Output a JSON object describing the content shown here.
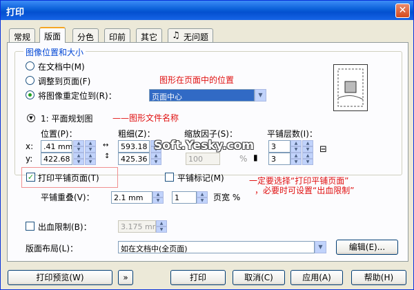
{
  "window": {
    "title": "打印",
    "close": "✕"
  },
  "tabs": [
    "常规",
    "版面",
    "分色",
    "印前",
    "其它",
    "无问题"
  ],
  "group": {
    "title": "图像位置和大小",
    "radio1": "在文档中(M)",
    "radio2": "调整到页面(F)",
    "radio3": "将图像重定位到(R)：",
    "reposition_value": "页面中心",
    "annotation_position": "图形在页面中的位置",
    "plan_label": "1: 平面规划图",
    "annotation_file": "——图形文件名称",
    "position_label": "位置(P)：",
    "x_label": "x:",
    "y_label": "y:",
    "x_value": ".41 mm",
    "y_value": "422.68",
    "size_label": "粗细(Z)：",
    "width_value": "593.18",
    "height_value": "425.36",
    "scale_label": "缩放因子(S)：",
    "scale_value": "100",
    "scale_unit": "%",
    "tile_count_label": "平铺层数(I)：",
    "tile_x": "3",
    "tile_y": "3"
  },
  "tile_pages": {
    "label": "打印平铺页面(T)",
    "checked": true
  },
  "tile_marks": {
    "label": "平铺标记(M)",
    "checked": false
  },
  "annotation_tile": [
    "一定要选择“打印平铺页面”",
    "，必要时可设置“出血限制”"
  ],
  "tile_overlap": {
    "label": "平铺重叠(V)：",
    "value": "2.1 mm",
    "pages_value": "1",
    "pages_label": "页宽 %"
  },
  "bleed": {
    "label": "出血限制(B)：",
    "value": "3.175 mm",
    "checked": false
  },
  "layout": {
    "label": "版面布局(L)：",
    "value": "如在文档中(全页面)",
    "edit": "编辑(E)..."
  },
  "footer": {
    "preview": "打印预览(W)",
    "expand": "»",
    "print": "打印",
    "cancel": "取消(C)",
    "apply": "应用(A)",
    "help": "帮助(H)"
  },
  "watermark": "Soft.Yesky.com"
}
